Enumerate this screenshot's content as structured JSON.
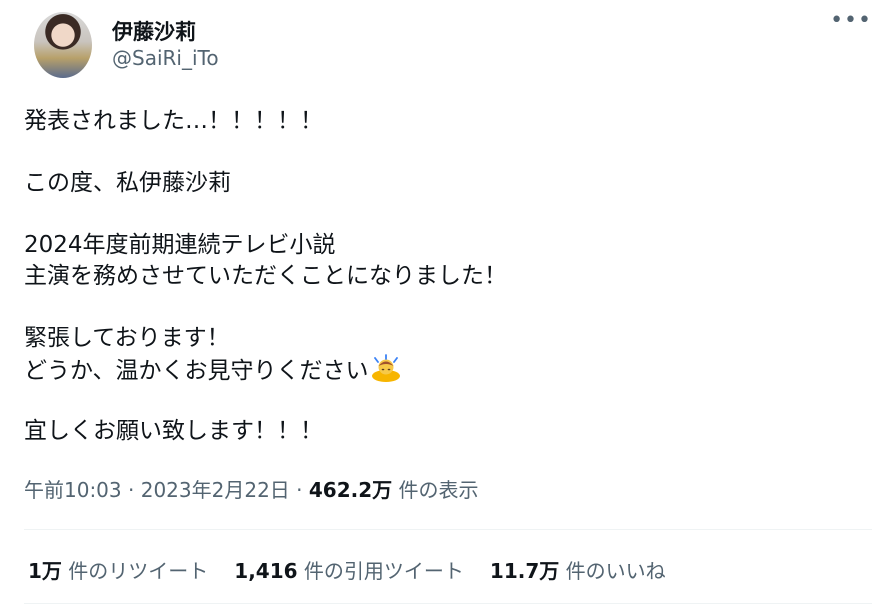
{
  "user": {
    "display_name": "伊藤沙莉",
    "handle": "@SaiRi_iTo"
  },
  "more_label": "•••",
  "tweet": {
    "lines": [
      "発表されました…！！！！！",
      "",
      "この度、私伊藤沙莉",
      "",
      "2024年度前期連続テレビ小説",
      "主演を務めさせていただくことになりました！",
      "",
      "緊張しております！",
      "どうか、温かくお見守りください",
      "",
      "宜しくお願い致します！！！"
    ],
    "emoji_icon": "person-bowing-emoji"
  },
  "meta": {
    "time": "午前10:03",
    "sep1": " · ",
    "date": "2023年2月22日",
    "sep2": " · ",
    "views": "462.2万",
    "views_label": " 件の表示"
  },
  "stats": {
    "retweets": "1万",
    "retweets_label": " 件のリツイート",
    "quotes": "1,416",
    "quotes_label": " 件の引用ツイート",
    "likes": "11.7万",
    "likes_label": " 件のいいね"
  }
}
